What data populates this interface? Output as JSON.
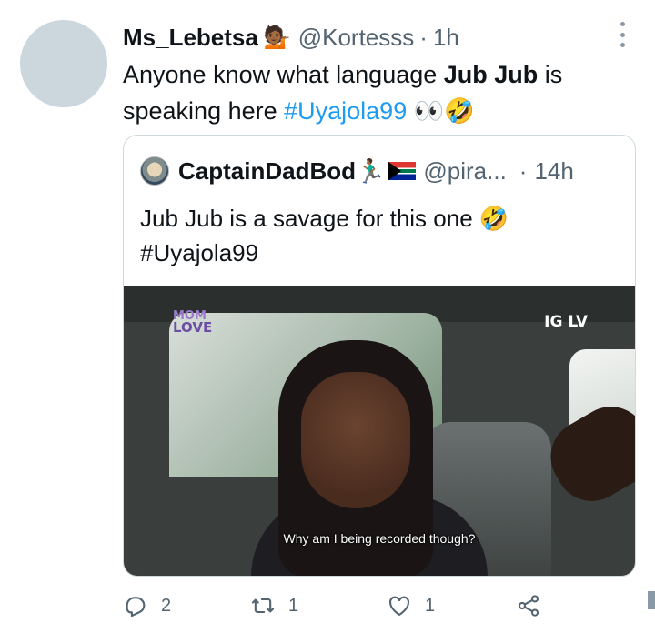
{
  "tweet": {
    "author_name": "Ms_Lebetsa",
    "author_emoji": "💁🏾",
    "handle": "@Kortesss",
    "separator": "·",
    "time": "1h",
    "text_part1": "Anyone know what language ",
    "text_bold": "Jub Jub",
    "text_part2": " is speaking here ",
    "hashtag": "#Uyajola99",
    "text_emoji": "👀🤣"
  },
  "quote": {
    "author_name": "CaptainDadBod",
    "author_emoji": "🏃🏾‍♂️",
    "handle": "@pira...",
    "separator": "·",
    "time": "14h",
    "text_line1": "Jub Jub is a savage for this one 🤣",
    "hashtag": "#Uyajola99",
    "media": {
      "logo_left_top": "MOM",
      "logo_left_bottom": "LOVE",
      "logo_right": "IG LV",
      "subtitle": "Why am I being recorded though?"
    }
  },
  "actions": {
    "reply_count": "2",
    "retweet_count": "1",
    "like_count": "1"
  },
  "icons": [
    "more-icon",
    "reply-icon",
    "retweet-icon",
    "like-icon",
    "share-icon"
  ],
  "colors": {
    "link": "#1d9bf0",
    "secondary_text": "#536471",
    "border": "#cfd9de"
  }
}
